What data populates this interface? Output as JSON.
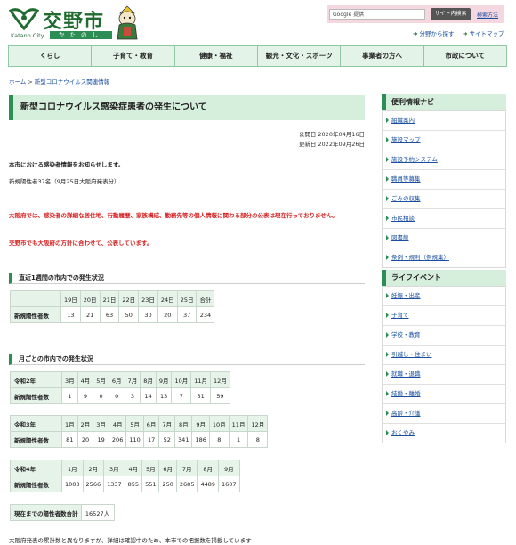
{
  "header": {
    "logo_text": "交野市",
    "logo_en": "Katano City",
    "logo_kana": "かたのし",
    "search_placeholder": "Google 提供",
    "search_button": "サイト内検索",
    "search_help": "検索方法",
    "util_links": [
      "分野から探す",
      "サイトマップ"
    ]
  },
  "nav": [
    "くらし",
    "子育て・教育",
    "健康・福祉",
    "観光・文化・スポーツ",
    "事業者の方へ",
    "市政について"
  ],
  "breadcrumb": [
    "ホーム",
    "新型コロナウイルス関連情報"
  ],
  "main": {
    "title": "新型コロナウイルス感染症患者の発生について",
    "published": "公開日 2020年04月16日",
    "updated": "更新日 2022年09月26日",
    "intro": "本市における感染者情報をお知らせします。",
    "new_cases": "新規陽性者37名（9月25日大阪府発表分）",
    "red1": "大阪府では、感染者の詳細な居住地、行動履歴、家族構成、勤務先等の個人情報に関わる部分の公表は現在行っておりません。",
    "red2": "交野市でも大阪府の方針に合わせて、公表しています。",
    "weekly_heading": "直近1週間の市内での発生状況",
    "monthly_heading": "月ごとの市内での発生状況",
    "row_label": "新規陽性者数",
    "weekly": {
      "days": [
        "19日",
        "20日",
        "21日",
        "22日",
        "23日",
        "24日",
        "25日",
        "合計"
      ],
      "values": [
        "13",
        "21",
        "63",
        "50",
        "30",
        "20",
        "37",
        "234"
      ]
    },
    "r2": {
      "year": "令和2年",
      "months": [
        "3月",
        "4月",
        "5月",
        "6月",
        "7月",
        "8月",
        "9月",
        "10月",
        "11月",
        "12月"
      ],
      "values": [
        "1",
        "9",
        "0",
        "0",
        "3",
        "14",
        "13",
        "7",
        "31",
        "59"
      ]
    },
    "r3": {
      "year": "令和3年",
      "months": [
        "1月",
        "2月",
        "3月",
        "4月",
        "5月",
        "6月",
        "7月",
        "8月",
        "9月",
        "10月",
        "11月",
        "12月"
      ],
      "values": [
        "81",
        "20",
        "19",
        "206",
        "110",
        "17",
        "52",
        "341",
        "186",
        "8",
        "1",
        "8"
      ]
    },
    "r4": {
      "year": "令和4年",
      "months": [
        "1月",
        "2月",
        "3月",
        "4月",
        "5月",
        "6月",
        "7月",
        "8月",
        "9月"
      ],
      "values": [
        "1003",
        "2566",
        "1337",
        "855",
        "551",
        "250",
        "2685",
        "4489",
        "1607"
      ]
    },
    "total_label": "現在までの陽性者数合計",
    "total_value": "16527人",
    "footnote": "大阪府発表の累計数と異なりますが、詳細は確認中のため、本市での把握数を掲載しています"
  },
  "sidebar": {
    "nav_heading": "便利情報ナビ",
    "nav_items": [
      "組織案内",
      "施設マップ",
      "施設予約システム",
      "職員等募集",
      "ごみの収集",
      "市民相談",
      "図書館",
      "条例・規則（例規集）"
    ],
    "life_heading": "ライフイベント",
    "life_items": [
      "妊娠・出産",
      "子育て",
      "学校・教育",
      "引越し・住まい",
      "就職・退職",
      "結婚・離婚",
      "高齢・介護",
      "おくやみ"
    ]
  }
}
